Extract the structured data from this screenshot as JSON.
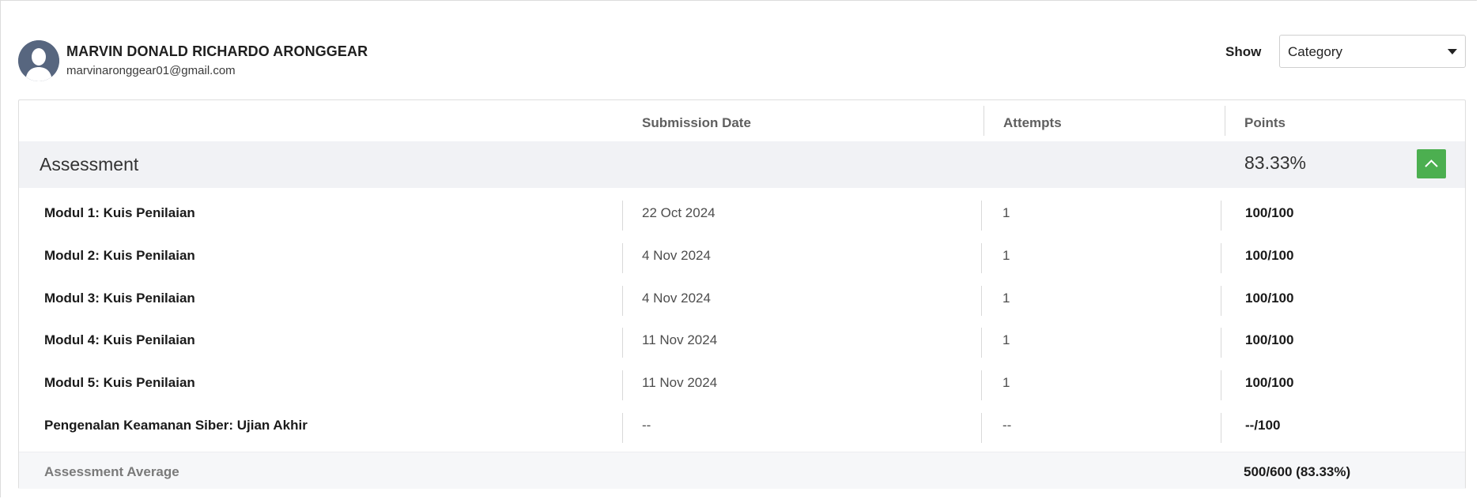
{
  "user": {
    "name": "MARVIN DONALD RICHARDO ARONGGEAR",
    "email": "marvinaronggear01@gmail.com",
    "avatar_icon": "user-silhouette-icon"
  },
  "filter": {
    "label": "Show",
    "selected": "Category"
  },
  "table": {
    "headers": {
      "submission_date": "Submission Date",
      "attempts": "Attempts",
      "points": "Points"
    },
    "group": {
      "title": "Assessment",
      "score": "83.33%",
      "toggle_icon": "chevron-up-icon",
      "toggle_color": "#4caf50"
    },
    "rows": [
      {
        "name": "Modul 1: Kuis Penilaian",
        "date": "22 Oct 2024",
        "attempts": "1",
        "points": "100/100"
      },
      {
        "name": "Modul 2: Kuis Penilaian",
        "date": "4 Nov 2024",
        "attempts": "1",
        "points": "100/100"
      },
      {
        "name": "Modul 3: Kuis Penilaian",
        "date": "4 Nov 2024",
        "attempts": "1",
        "points": "100/100"
      },
      {
        "name": "Modul 4: Kuis Penilaian",
        "date": "11 Nov 2024",
        "attempts": "1",
        "points": "100/100"
      },
      {
        "name": "Modul 5: Kuis Penilaian",
        "date": "11 Nov 2024",
        "attempts": "1",
        "points": "100/100"
      },
      {
        "name": "Pengenalan Keamanan Siber: Ujian Akhir",
        "date": "--",
        "attempts": "--",
        "points": "--/100"
      }
    ],
    "average": {
      "label": "Assessment Average",
      "value": "500/600 (83.33%)"
    }
  }
}
